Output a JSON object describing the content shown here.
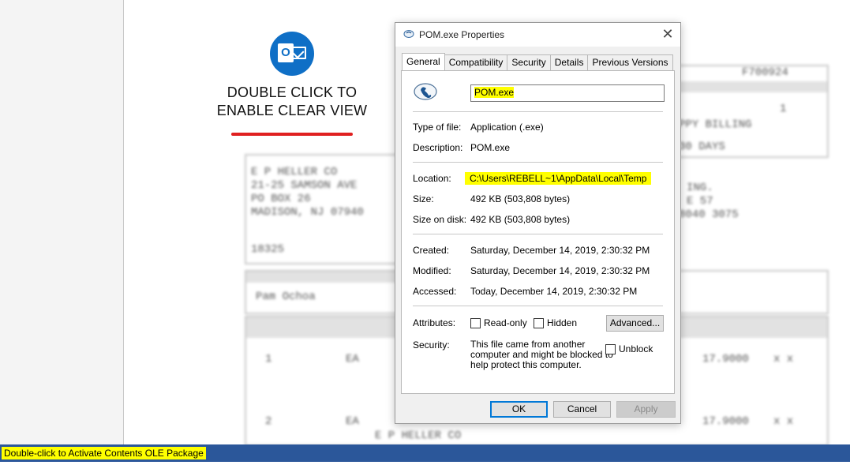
{
  "lure": {
    "icon": "outlook-icon",
    "line1": "DOUBLE CLICK TO",
    "line2": "ENABLE CLEAR VIEW",
    "accent": "#e02020"
  },
  "document": {
    "ref": "F700924",
    "vendor": [
      "E P HELLER CO",
      "21-25 SAMSON AVE",
      "PO BOX 26",
      "MADISON, NJ  07940"
    ],
    "vendor_no": "18325",
    "buyer": "Pam Ochoa",
    "rows": [
      {
        "line": "1",
        "uom": "EA",
        "price": "17.9000"
      },
      {
        "line": "2",
        "uom": "EA",
        "price": "17.9000"
      }
    ]
  },
  "dialog": {
    "title": "POM.exe Properties",
    "close": "✕",
    "tabs": [
      "General",
      "Compatibility",
      "Security",
      "Details",
      "Previous Versions"
    ],
    "active_tab": "General",
    "file_name": "POM.exe",
    "fields": {
      "type_label": "Type of file:",
      "type_value": "Application (.exe)",
      "desc_label": "Description:",
      "desc_value": "POM.exe",
      "loc_label": "Location:",
      "loc_value": "C:\\Users\\REBELL~1\\AppData\\Local\\Temp",
      "size_label": "Size:",
      "size_value": "492 KB (503,808 bytes)",
      "disk_label": "Size on disk:",
      "disk_value": "492 KB (503,808 bytes)",
      "created_label": "Created:",
      "created_value": "Saturday, December 14, 2019, 2:30:32 PM",
      "modified_label": "Modified:",
      "modified_value": "Saturday, December 14, 2019, 2:30:32 PM",
      "accessed_label": "Accessed:",
      "accessed_value": "Today, December 14, 2019, 2:30:32 PM",
      "attr_label": "Attributes:",
      "readonly": "Read-only",
      "hidden": "Hidden",
      "advanced": "Advanced...",
      "security_label": "Security:",
      "security_text": [
        "This file came from another",
        "computer and might be blocked to",
        "help protect this computer."
      ],
      "unblock": "Unblock"
    },
    "buttons": {
      "ok": "OK",
      "cancel": "Cancel",
      "apply": "Apply"
    },
    "highlight_color": "#ffff00"
  },
  "statusbar": {
    "text": "Double-click to Activate Contents OLE Package",
    "color": "#2b579a"
  }
}
